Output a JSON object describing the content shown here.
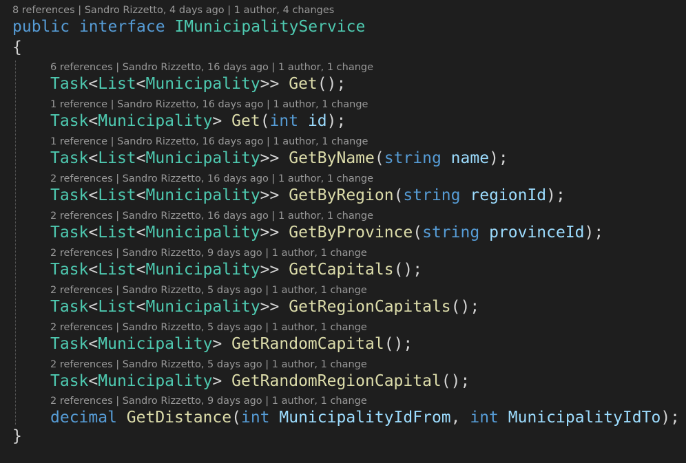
{
  "colors": {
    "background": "#1e1e1e",
    "keyword": "#569cd6",
    "type": "#4ec9b0",
    "method": "#dcdcaa",
    "parameter": "#9cdcfe",
    "punctuation": "#d4d4d4",
    "codelens": "#999999"
  },
  "header": {
    "codelens": "8 references | Sandro Rizzetto, 4 days ago | 1 author, 4 changes",
    "kw_public": "public",
    "kw_interface": "interface",
    "name": "IMunicipalityService",
    "open_brace": "{",
    "close_brace": "}"
  },
  "members": [
    {
      "codelens": "6 references | Sandro Rizzetto, 16 days ago | 1 author, 1 change",
      "ret_outer": "Task",
      "ret_mid": "List",
      "ret_inner": "Municipality",
      "ret_close": ">>",
      "name": "Get",
      "param_type": "",
      "param_name": "",
      "close": ");"
    },
    {
      "codelens": "1 reference | Sandro Rizzetto, 16 days ago | 1 author, 1 change",
      "ret_outer": "Task",
      "ret_mid": "",
      "ret_inner": "Municipality",
      "ret_close": ">",
      "name": "Get",
      "param_type": "int",
      "param_name": "id",
      "close": ");"
    },
    {
      "codelens": "1 reference | Sandro Rizzetto, 16 days ago | 1 author, 1 change",
      "ret_outer": "Task",
      "ret_mid": "List",
      "ret_inner": "Municipality",
      "ret_close": ">>",
      "name": "GetByName",
      "param_type": "string",
      "param_name": "name",
      "close": ");"
    },
    {
      "codelens": "2 references | Sandro Rizzetto, 16 days ago | 1 author, 1 change",
      "ret_outer": "Task",
      "ret_mid": "List",
      "ret_inner": "Municipality",
      "ret_close": ">>",
      "name": "GetByRegion",
      "param_type": "string",
      "param_name": "regionId",
      "close": ");"
    },
    {
      "codelens": "2 references | Sandro Rizzetto, 16 days ago | 1 author, 1 change",
      "ret_outer": "Task",
      "ret_mid": "List",
      "ret_inner": "Municipality",
      "ret_close": ">>",
      "name": "GetByProvince",
      "param_type": "string",
      "param_name": "provinceId",
      "close": ");"
    },
    {
      "codelens": "2 references | Sandro Rizzetto, 9 days ago | 1 author, 1 change",
      "ret_outer": "Task",
      "ret_mid": "List",
      "ret_inner": "Municipality",
      "ret_close": ">>",
      "name": "GetCapitals",
      "param_type": "",
      "param_name": "",
      "close": ");"
    },
    {
      "codelens": "2 references | Sandro Rizzetto, 5 days ago | 1 author, 1 change",
      "ret_outer": "Task",
      "ret_mid": "List",
      "ret_inner": "Municipality",
      "ret_close": ">>",
      "name": "GetRegionCapitals",
      "param_type": "",
      "param_name": "",
      "close": ");"
    },
    {
      "codelens": "2 references | Sandro Rizzetto, 5 days ago | 1 author, 1 change",
      "ret_outer": "Task",
      "ret_mid": "",
      "ret_inner": "Municipality",
      "ret_close": ">",
      "name": "GetRandomCapital",
      "param_type": "",
      "param_name": "",
      "close": ");"
    },
    {
      "codelens": "2 references | Sandro Rizzetto, 5 days ago | 1 author, 1 change",
      "ret_outer": "Task",
      "ret_mid": "",
      "ret_inner": "Municipality",
      "ret_close": ">",
      "name": "GetRandomRegionCapital",
      "param_type": "",
      "param_name": "",
      "close": ");"
    }
  ],
  "last_member": {
    "codelens": "2 references | Sandro Rizzetto, 9 days ago | 1 author, 1 change",
    "ret_type": "decimal",
    "name": "GetDistance",
    "p1_type": "int",
    "p1_name": "MunicipalityIdFrom",
    "comma": ",",
    "p2_type": "int",
    "p2_name": "MunicipalityIdTo",
    "close": ");"
  }
}
